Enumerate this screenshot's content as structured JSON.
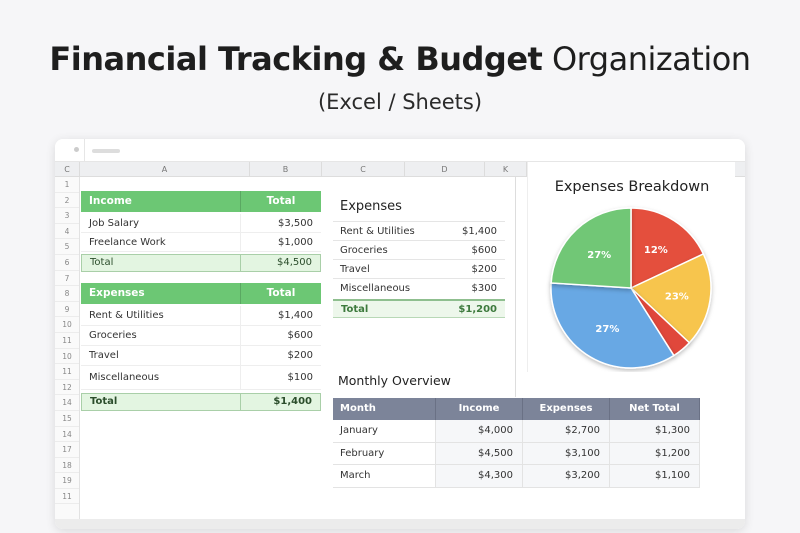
{
  "title": {
    "bold": "Financial Tracking & Budget",
    "regular": "Organization"
  },
  "subtitle": "(Excel / Sheets)",
  "columns": [
    "C",
    "A",
    "B",
    "C",
    "D",
    "K"
  ],
  "rows": [
    "1",
    "2",
    "3",
    "4",
    "5",
    "6",
    "7",
    "8",
    "9",
    "10",
    "11",
    "10",
    "11",
    "12",
    "14",
    "15",
    "14",
    "17",
    "18",
    "19",
    "11"
  ],
  "income_table": {
    "header": [
      "Income",
      "Total"
    ],
    "rows": [
      [
        "Job Salary",
        "$3,500"
      ],
      [
        "Freelance Work",
        "$1,000"
      ]
    ],
    "total": [
      "Total",
      "$4,500"
    ]
  },
  "expenses_table": {
    "header": [
      "Expenses",
      "Total"
    ],
    "rows": [
      [
        "Rent & Utilities",
        "$1,400"
      ],
      [
        "Groceries",
        "$600"
      ],
      [
        "Travel",
        "$200"
      ],
      [
        "Miscellaneous",
        "$100"
      ]
    ],
    "total": [
      "Total",
      "$1,400"
    ]
  },
  "expenses_list": {
    "title": "Expenses",
    "rows": [
      [
        "Rent & Utilities",
        "$1,400"
      ],
      [
        "Groceries",
        "$600"
      ],
      [
        "Travel",
        "$200"
      ],
      [
        "Miscellaneous",
        "$300"
      ]
    ],
    "total": [
      "Total",
      "$1,200"
    ]
  },
  "monthly": {
    "title": "Monthly Overview",
    "header": [
      "Month",
      "Income",
      "Expenses",
      "Net Total"
    ],
    "rows": [
      [
        "January",
        "$4,000",
        "$2,700",
        "$1,300"
      ],
      [
        "February",
        "$4,500",
        "$3,100",
        "$1,200"
      ],
      [
        "March",
        "$4,300",
        "$3,200",
        "$1,100"
      ]
    ]
  },
  "chart_data": {
    "type": "pie",
    "title": "Expenses Breakdown",
    "slices": [
      {
        "label": "12%",
        "value": 18,
        "color": "#e4503e"
      },
      {
        "label": "23%",
        "value": 19,
        "color": "#f7c54d"
      },
      {
        "label": "",
        "value": 4,
        "color": "#e0463a"
      },
      {
        "label": "27%",
        "value": 35,
        "color": "#67a8e4"
      },
      {
        "label": "27%",
        "value": 24,
        "color": "#71c776"
      }
    ]
  }
}
